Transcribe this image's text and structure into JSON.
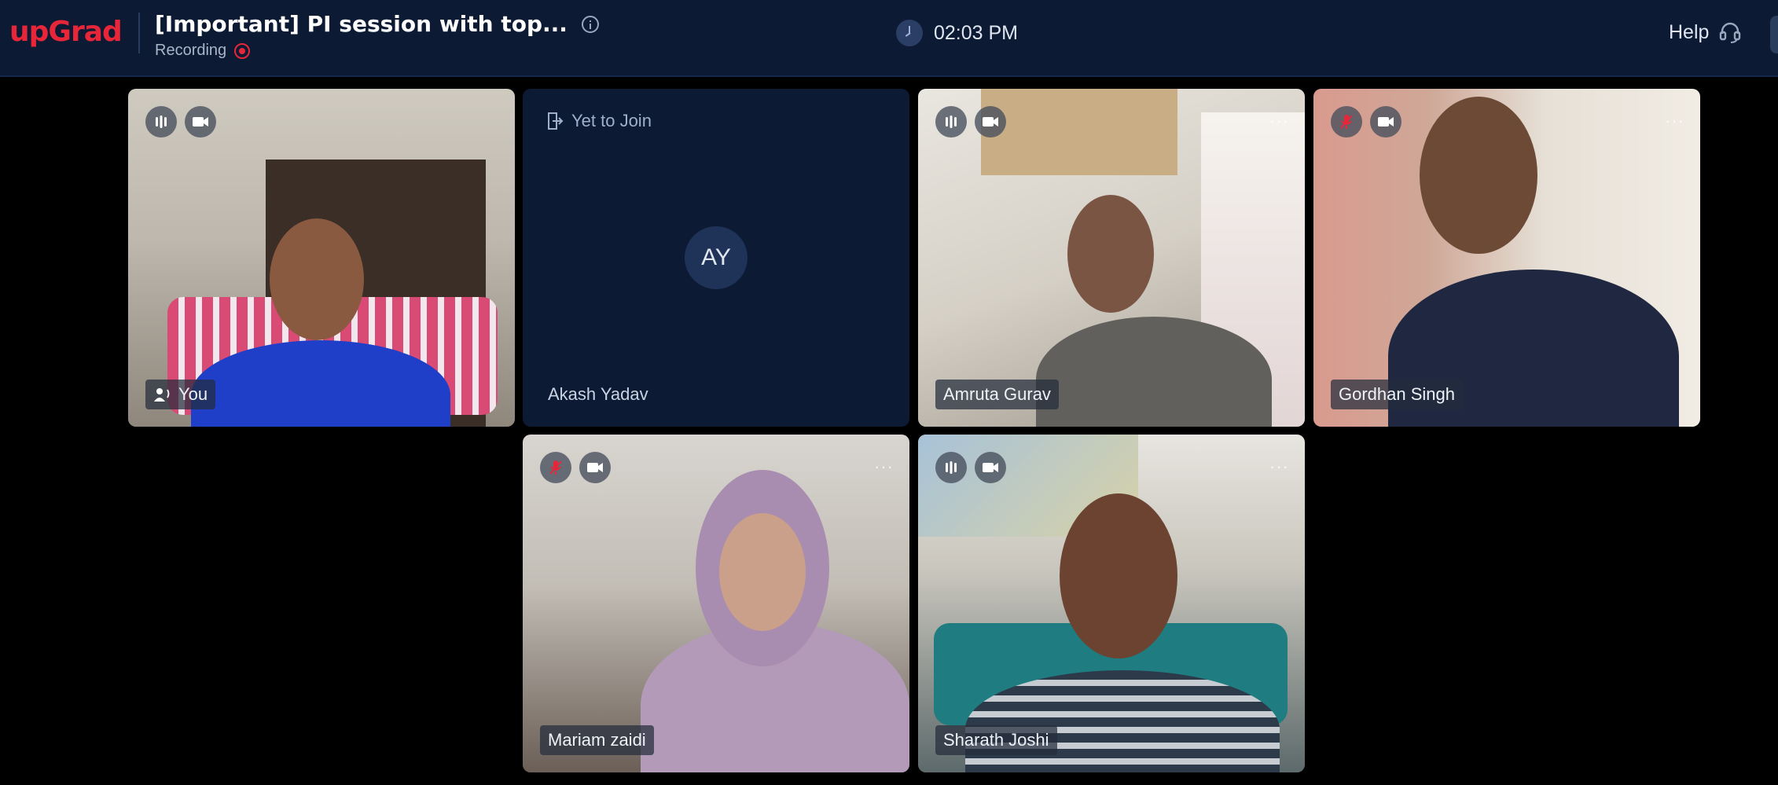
{
  "header": {
    "logo": "upGrad",
    "title": "[Important] PI session with top...",
    "recording_label": "Recording",
    "time": "02:03 PM",
    "help_label": "Help"
  },
  "participants": [
    {
      "name": "You",
      "status": "",
      "initials": "",
      "mic": "on",
      "camera": "on",
      "menu": ""
    },
    {
      "name": "Akash Yadav",
      "status": "Yet to Join",
      "initials": "AY",
      "mic": "",
      "camera": "",
      "menu": ""
    },
    {
      "name": "Amruta Gurav",
      "status": "",
      "initials": "",
      "mic": "on",
      "camera": "on",
      "menu": "···"
    },
    {
      "name": "Gordhan Singh",
      "status": "",
      "initials": "",
      "mic": "muted",
      "camera": "on",
      "menu": "···"
    },
    {
      "name": "Mariam zaidi",
      "status": "",
      "initials": "",
      "mic": "muted",
      "camera": "on",
      "menu": "···"
    },
    {
      "name": "Sharath Joshi",
      "status": "",
      "initials": "",
      "mic": "on",
      "camera": "on",
      "menu": "···"
    }
  ],
  "colors": {
    "brand": "#e8263a",
    "header_bg": "#0c1a33",
    "tile_empty_bg": "#0c1a33",
    "page_bg": "#000000"
  }
}
